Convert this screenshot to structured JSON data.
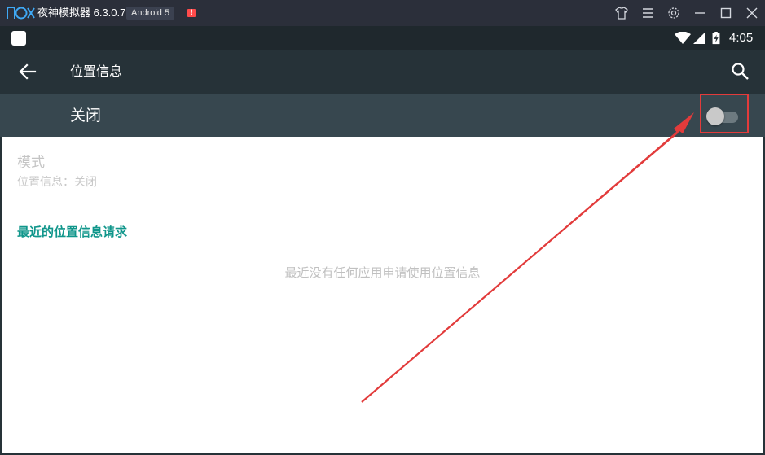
{
  "titlebar": {
    "logo": "nox",
    "app_title": "夜神模拟器 6.3.0.7",
    "android_badge": "Android 5",
    "alert_badge": "!"
  },
  "statusbar": {
    "time": "4:05"
  },
  "actionbar": {
    "title": "位置信息"
  },
  "master_switch": {
    "label": "关闭",
    "state": "off"
  },
  "mode": {
    "title": "模式",
    "summary": "位置信息：关闭"
  },
  "recent_requests": {
    "header": "最近的位置信息请求",
    "empty_text": "最近没有任何应用申请使用位置信息"
  },
  "colors": {
    "titlebar_bg": "#2b2f3a",
    "statusbar_bg": "#1f282d",
    "actionbar_bg": "#263238",
    "switchbar_bg": "#37474f",
    "accent": "#10968b",
    "annotation_red": "#e23b3b"
  },
  "icons": {
    "titlebar": [
      "shirt-icon",
      "menu-icon",
      "gear-icon",
      "minimize-icon",
      "maximize-icon",
      "close-icon"
    ],
    "statusbar": [
      "wifi-icon",
      "signal-icon",
      "battery-charging-icon"
    ],
    "actionbar": [
      "back-arrow-icon",
      "search-icon"
    ]
  }
}
